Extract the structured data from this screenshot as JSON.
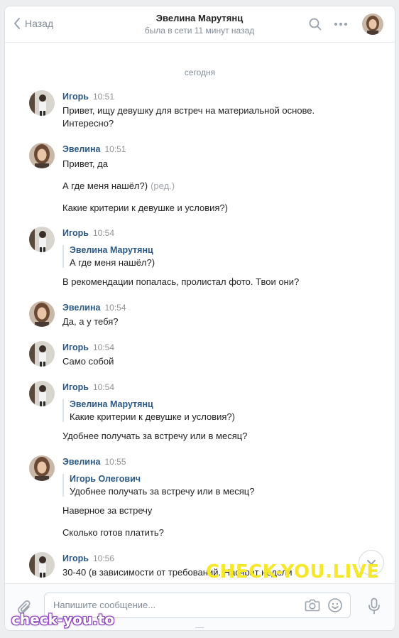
{
  "header": {
    "back_label": "Назад",
    "contact_name": "Эвелина Марутянц",
    "status": "была в сети 11 минут назад"
  },
  "date_separator": "сегодня",
  "messages": [
    {
      "author": "Игорь",
      "time": "10:51",
      "lines": [
        "Привет, ищу девушку для встреч на материальной основе.",
        "Интересно?"
      ]
    },
    {
      "author": "Эвелина",
      "time": "10:51",
      "lines": [
        "Привет, да",
        "А где меня нашёл?)",
        "Какие критерии к девушке и условия?)"
      ],
      "edited_label": "(ред.)"
    },
    {
      "author": "Игорь",
      "time": "10:54",
      "quote": {
        "name": "Эвелина Марутянц",
        "text": "А где меня нашёл?)"
      },
      "lines": [
        "В рекомендации попалась, пролистал фото. Твои они?"
      ]
    },
    {
      "author": "Эвелина",
      "time": "10:54",
      "lines": [
        "Да, а у тебя?"
      ]
    },
    {
      "author": "Игорь",
      "time": "10:54",
      "lines": [
        "Само собой"
      ]
    },
    {
      "author": "Игорь",
      "time": "10:54",
      "quote": {
        "name": "Эвелина Марутянц",
        "text": "Какие критерии к девушке и условия?)"
      },
      "lines": [
        "Удобнее получать за встречу или в месяц?"
      ]
    },
    {
      "author": "Эвелина",
      "time": "10:55",
      "quote": {
        "name": "Игорь Олегович",
        "text": "Удобнее получать за встречу или в месяц?"
      },
      "lines": [
        "Наверное за встречу",
        "Сколько готов платить?"
      ]
    },
    {
      "author": "Игорь",
      "time": "10:56",
      "lines": [
        "30-40 (в зависимости от требований. Насчрат недели"
      ]
    }
  ],
  "composer": {
    "placeholder": "Напишите сообщение..."
  },
  "watermarks": {
    "big": "CHECK-YOU.LIVE",
    "small": "check-you.to"
  },
  "colors": {
    "link": "#2a5885",
    "secondary": "#818c99",
    "watermark_yellow": "#f5e72b",
    "watermark_purple": "#8a3fb7"
  },
  "icons": [
    "back-chevron-icon",
    "search-icon",
    "more-icon",
    "attach-icon",
    "camera-icon",
    "emoji-icon",
    "microphone-icon",
    "chevron-down-icon"
  ]
}
